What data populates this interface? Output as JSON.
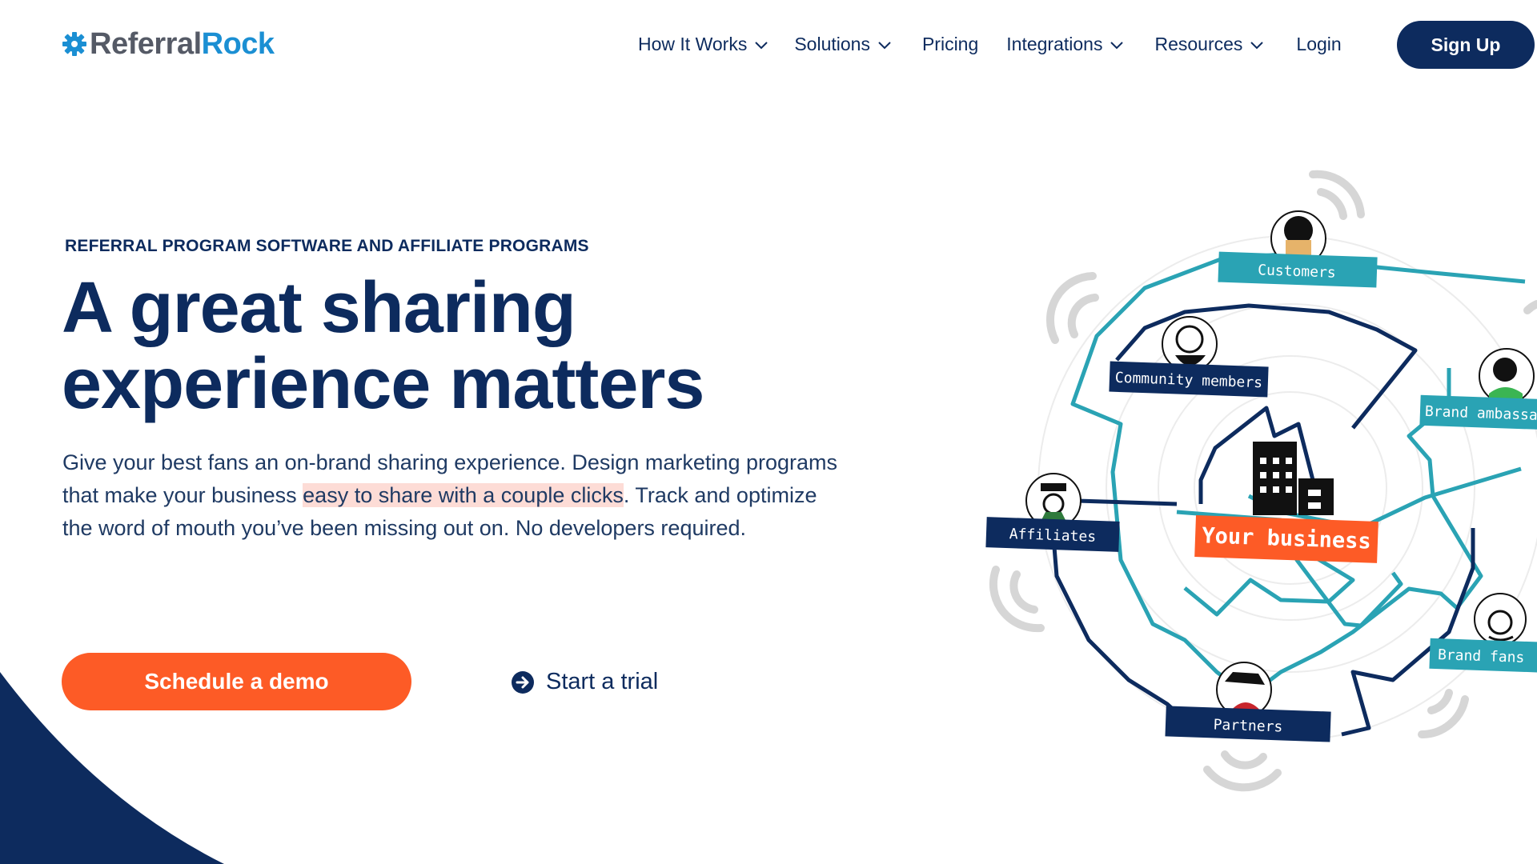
{
  "brand": {
    "name_part1": "Referral",
    "name_part2": "Rock"
  },
  "nav": {
    "items": [
      {
        "label": "How It Works",
        "has_dropdown": true
      },
      {
        "label": "Solutions",
        "has_dropdown": true
      },
      {
        "label": "Pricing",
        "has_dropdown": false
      },
      {
        "label": "Integrations",
        "has_dropdown": true
      },
      {
        "label": "Resources",
        "has_dropdown": true
      },
      {
        "label": "Login",
        "has_dropdown": false
      }
    ],
    "signup_label": "Sign Up"
  },
  "hero": {
    "eyebrow": "REFERRAL PROGRAM SOFTWARE AND AFFILIATE PROGRAMS",
    "headline_line1": "A great sharing",
    "headline_line2": "experience matters",
    "desc_part1": "Give your best fans an on-brand sharing experience. Design marketing programs that make your business ",
    "desc_highlight": "easy to share with a couple clicks",
    "desc_part2": ". Track and optimize the word of mouth you’ve been missing out on. No developers required.",
    "cta_primary": "Schedule a demo",
    "cta_secondary": "Start a trial"
  },
  "illustration": {
    "center_label": "Your business",
    "labels": {
      "customers": "Customers",
      "community": "Community members",
      "ambassadors": "Brand ambassa",
      "affiliates": "Affiliates",
      "fans": "Brand fans",
      "partners": "Partners"
    }
  },
  "colors": {
    "navy": "#0d2b5e",
    "orange": "#fd5b26",
    "teal": "#2aa3b4",
    "brand_blue": "#1b8fd3",
    "highlight": "#fddcd6"
  }
}
